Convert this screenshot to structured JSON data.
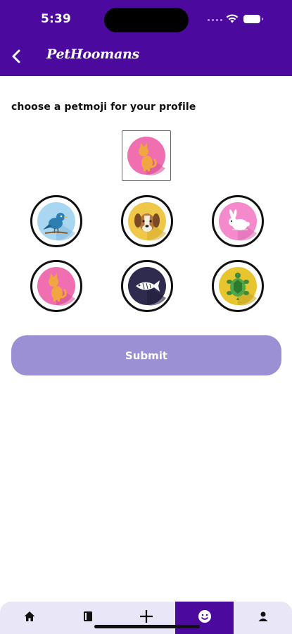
{
  "status_bar": {
    "time": "5:39"
  },
  "header": {
    "title": "PetHoomans",
    "back_icon": "chevron-left-icon"
  },
  "main": {
    "prompt": "choose a petmoji for your profile",
    "selected_petmoji": "cat",
    "options": [
      {
        "name": "bird",
        "icon": "bird-icon"
      },
      {
        "name": "dog",
        "icon": "dog-icon"
      },
      {
        "name": "rabbit",
        "icon": "rabbit-icon"
      },
      {
        "name": "cat",
        "icon": "cat-icon"
      },
      {
        "name": "fish",
        "icon": "fish-icon"
      },
      {
        "name": "turtle",
        "icon": "turtle-icon"
      }
    ],
    "submit_label": "Submit"
  },
  "bottom_nav": {
    "active_index": 3,
    "items": [
      {
        "icon": "home-icon"
      },
      {
        "icon": "book-icon"
      },
      {
        "icon": "plus-icon"
      },
      {
        "icon": "smiley-icon"
      },
      {
        "icon": "person-icon"
      }
    ]
  },
  "colors": {
    "brand_purple": "#4B0A9D",
    "submit_bg": "#9B90D4",
    "nav_bg": "#E8E6F7"
  }
}
